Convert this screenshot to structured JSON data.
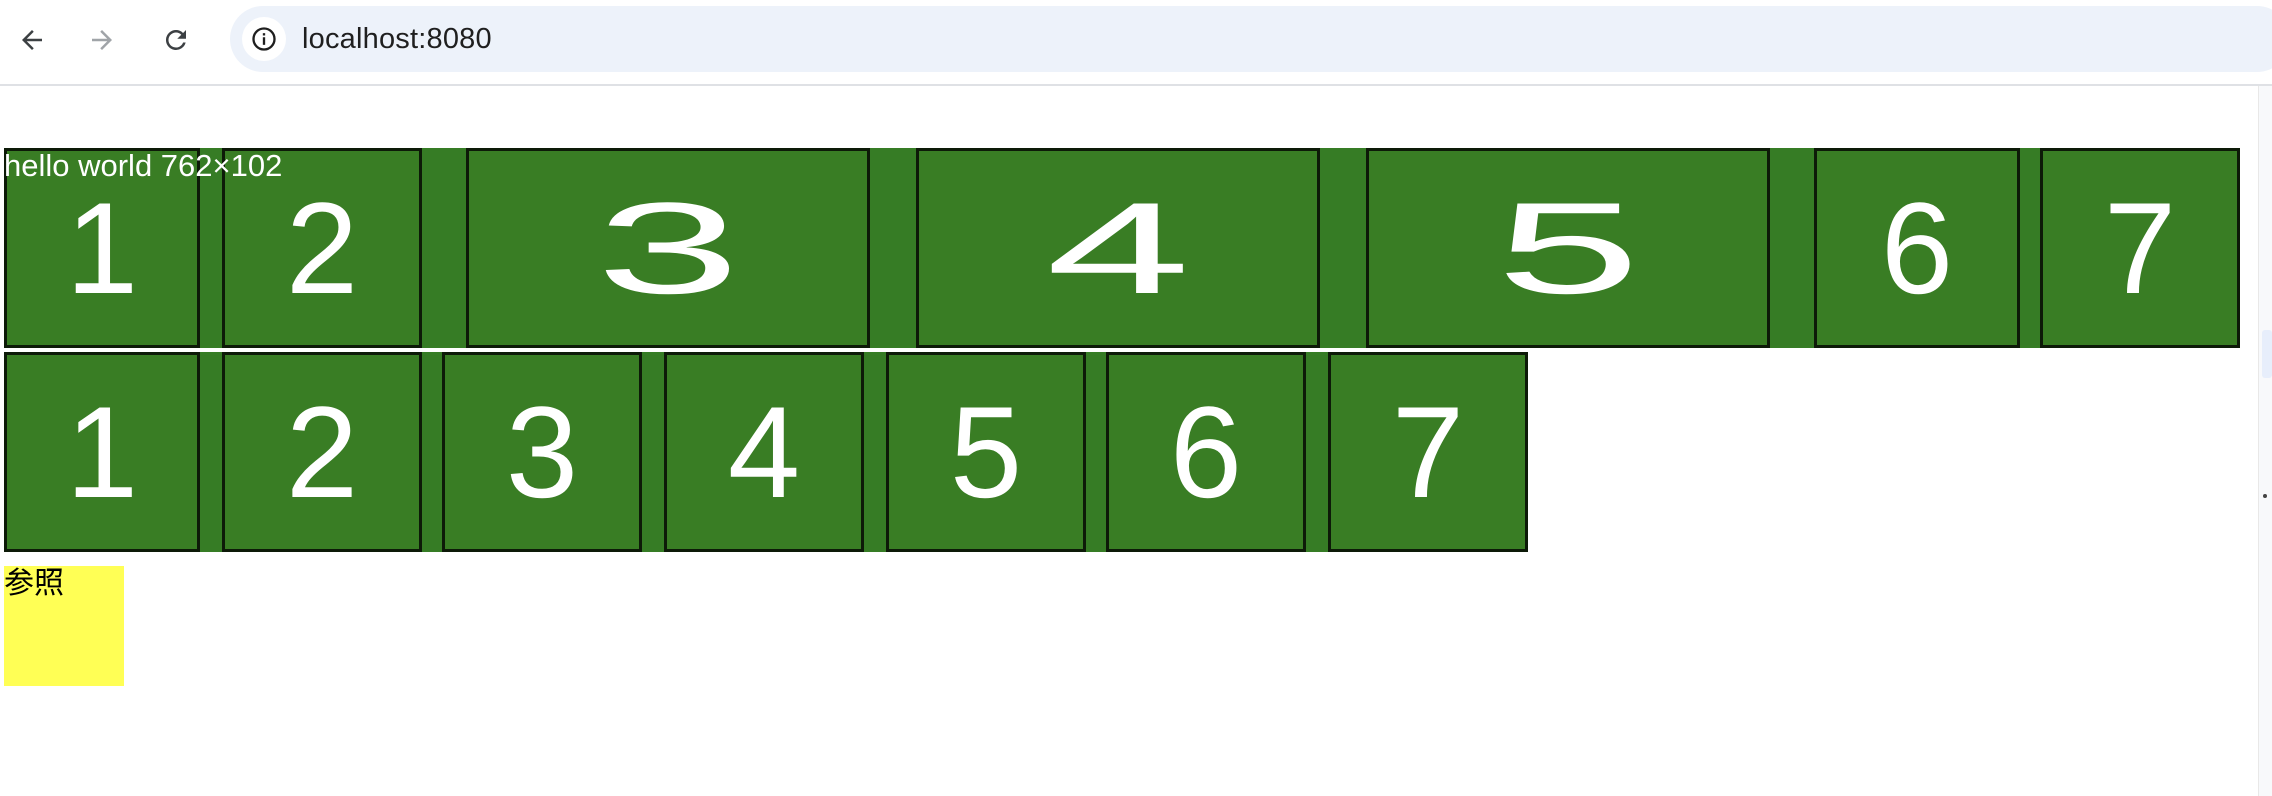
{
  "browser": {
    "url_host": "localhost",
    "url_port": ":8080",
    "icons": [
      "back-arrow-icon",
      "forward-arrow-icon",
      "reload-icon",
      "site-info-icon",
      "chevron-icon"
    ]
  },
  "content": {
    "overlay_label": "hello world 762×102",
    "wide_row": {
      "labels": [
        "1",
        "2",
        "3",
        "4",
        "5",
        "6",
        "7"
      ]
    },
    "square_row": {
      "labels": [
        "1",
        "2",
        "3",
        "4",
        "5",
        "6",
        "7"
      ]
    },
    "reference_box": {
      "label": "参照",
      "color": "#ffff55"
    },
    "colors": {
      "tile_green": "#397d24",
      "tile_border": "#0d1a08",
      "digit": "#ffffff"
    }
  }
}
